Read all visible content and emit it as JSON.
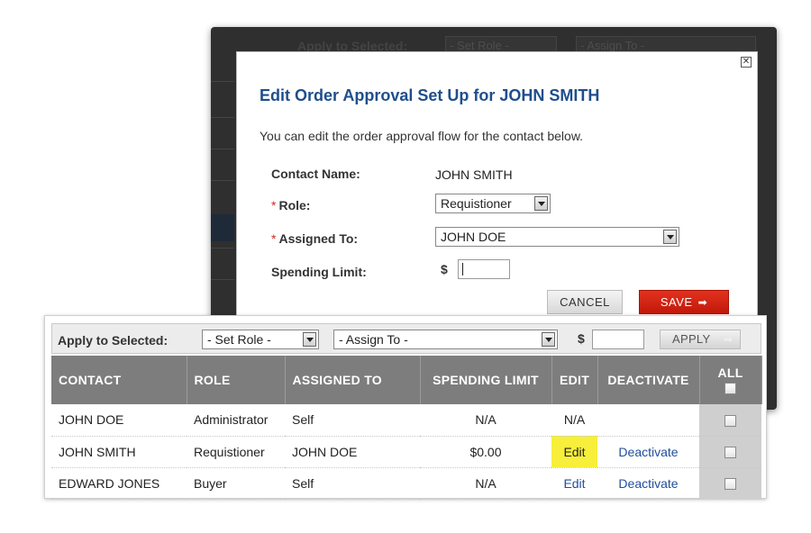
{
  "background_page": {
    "toolbar_label": "Apply to Selected:",
    "set_role": "- Set Role -",
    "assign_to": "- Assign To -"
  },
  "modal": {
    "close_icon": "close-icon",
    "title": "Edit Order Approval Set Up for JOHN SMITH",
    "description": "You can edit the order approval flow for the contact below.",
    "contact_name_label": "Contact Name:",
    "contact_name_value": "JOHN SMITH",
    "role_label": "Role:",
    "role_value": "Requistioner",
    "assigned_to_label": "Assigned To:",
    "assigned_to_value": "JOHN DOE",
    "spending_limit_label": "Spending Limit:",
    "currency_symbol": "$",
    "spending_limit_value": "",
    "required_marker": "*",
    "cancel_label": "CANCEL",
    "save_label": "SAVE",
    "save_arrow": "➡"
  },
  "toolbar": {
    "label": "Apply to Selected:",
    "set_role": "- Set Role -",
    "assign_to": "- Assign To -",
    "currency_symbol": "$",
    "amount_value": "",
    "apply_label": "APPLY",
    "apply_arrow": "➡"
  },
  "table": {
    "headers": {
      "contact": "CONTACT",
      "role": "ROLE",
      "assigned_to": "ASSIGNED TO",
      "spending_limit": "SPENDING LIMIT",
      "edit": "EDIT",
      "deactivate": "DEACTIVATE",
      "all": "ALL"
    },
    "rows": [
      {
        "contact": "JOHN DOE",
        "role": "Administrator",
        "assigned_to": "Self",
        "spending_limit": "N/A",
        "edit": "N/A",
        "deactivate": ""
      },
      {
        "contact": "JOHN SMITH",
        "role": "Requistioner",
        "assigned_to": "JOHN DOE",
        "spending_limit": "$0.00",
        "edit": "Edit",
        "deactivate": "Deactivate"
      },
      {
        "contact": "EDWARD JONES",
        "role": "Buyer",
        "assigned_to": "Self",
        "spending_limit": "N/A",
        "edit": "Edit",
        "deactivate": "Deactivate"
      }
    ]
  },
  "colors": {
    "title_blue": "#1f4e8c",
    "save_red": "#d9281f",
    "highlight_yellow": "#f7ef3b",
    "header_gray": "#7d7d7d"
  }
}
